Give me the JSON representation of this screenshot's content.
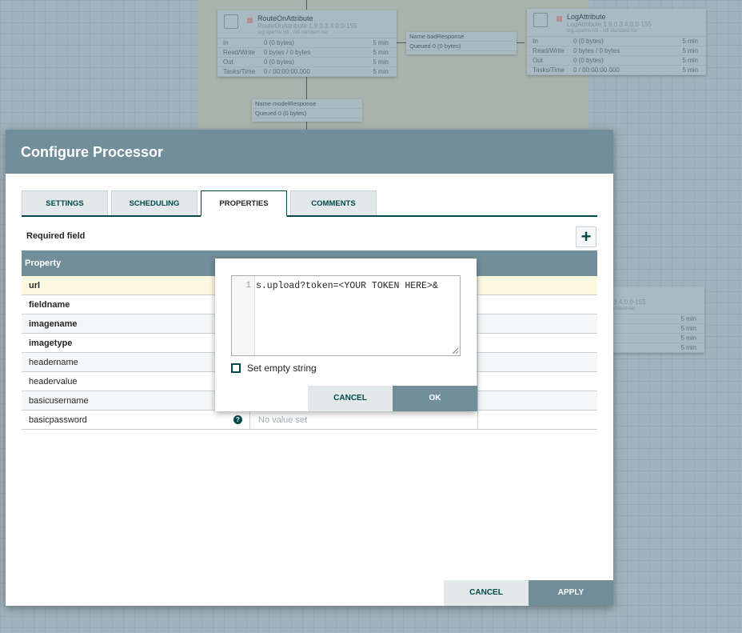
{
  "canvas": {
    "processors": [
      {
        "name": "RouteOnAttribute",
        "type": "RouteOnAttribute 1.9.0.3.4.0.0-155",
        "bundle": "org.apache.nifi - nifi-standard-nar",
        "stats": [
          [
            "In",
            "0 (0 bytes)",
            "5 min"
          ],
          [
            "Read/Write",
            "0 bytes / 0 bytes",
            "5 min"
          ],
          [
            "Out",
            "0 (0 bytes)",
            "5 min"
          ],
          [
            "Tasks/Time",
            "0 / 00:00:00.000",
            "5 min"
          ]
        ]
      },
      {
        "name": "LogAttribute",
        "type": "LogAttribute 1.9.0.3.4.0.0-155",
        "bundle": "org.apache.nifi - nifi-standard-nar",
        "stats": [
          [
            "In",
            "0 (0 bytes)",
            "5 min"
          ],
          [
            "Read/Write",
            "0 bytes / 0 bytes",
            "5 min"
          ],
          [
            "Out",
            "0 (0 bytes)",
            "5 min"
          ],
          [
            "Tasks/Time",
            "0 / 00:00:00.000",
            "5 min"
          ]
        ]
      },
      {
        "type_partial": ".3.4.0.0-155",
        "bundle_partial": "andard-nar",
        "times": [
          "5 min",
          "5 min",
          "5 min",
          "5 min"
        ]
      }
    ],
    "connections": [
      {
        "name": "Name  badResponse",
        "queued": "Queued  0 (0 bytes)"
      },
      {
        "name": "Name  modelResponse",
        "queued": "Queued  0 (0 bytes)"
      }
    ]
  },
  "dialog": {
    "title": "Configure Processor",
    "tabs": [
      "SETTINGS",
      "SCHEDULING",
      "PROPERTIES",
      "COMMENTS"
    ],
    "active_tab": "PROPERTIES",
    "required_label": "Required field",
    "add_icon": "+",
    "table_header": "Property",
    "rows": [
      {
        "name": "url",
        "required": true
      },
      {
        "name": "fieldname",
        "required": true
      },
      {
        "name": "imagename",
        "required": true
      },
      {
        "name": "imagetype",
        "required": true
      },
      {
        "name": "headername",
        "required": false
      },
      {
        "name": "headervalue",
        "required": false
      },
      {
        "name": "basicusername",
        "required": false
      },
      {
        "name": "basicpassword",
        "required": false,
        "help": "?",
        "value": "No value set"
      }
    ],
    "cancel": "CANCEL",
    "apply": "APPLY"
  },
  "editor_popup": {
    "line_number": "1",
    "code": "s.upload?token=<YOUR TOKEN HERE>&",
    "checkbox_label": "Set empty string",
    "checked": false,
    "cancel": "CANCEL",
    "ok": "OK"
  },
  "colors": {
    "header": "#728e9b",
    "accent": "#004849",
    "selected_row": "#fff8e1"
  }
}
